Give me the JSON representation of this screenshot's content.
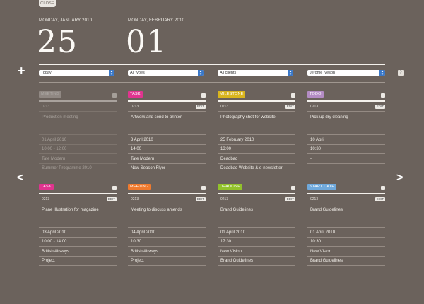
{
  "close_label": "CLOSE",
  "dates": [
    {
      "label": "MONDAY, JANUARY 2010",
      "day": "25"
    },
    {
      "label": "MONDAY, FEBRUARY 2010",
      "day": "01"
    }
  ],
  "filters": [
    {
      "value": "Today"
    },
    {
      "value": "All types"
    },
    {
      "value": "All clients"
    },
    {
      "value": "Jerome Iveson"
    }
  ],
  "help_label": "?",
  "nav": {
    "prev": "<",
    "next": ">"
  },
  "colors": {
    "background": "#6b625c",
    "meeting_faded": "#bdb8b3",
    "task": "#e0348f",
    "milestone": "#d9b51e",
    "todo": "#b48cc4",
    "meeting": "#f07a2e",
    "deadline": "#92c22b",
    "start_date": "#6fa9dc",
    "select_arrow": "#3a78c8"
  },
  "cards": [
    {
      "tag": "MEETING",
      "color": "meeting_faded",
      "num": "0213",
      "edit": "",
      "title": "Production meeting",
      "date": "01 April 2010",
      "time": "10:00 - 12:00",
      "client": "Tate Modern",
      "project": "Summer Programme 2010",
      "faded": true
    },
    {
      "tag": "TASK",
      "color": "task",
      "num": "0213",
      "edit": "EDIT",
      "title": "Artwork and send to printer",
      "date": "3 April 2010",
      "time": "14:00",
      "client": "Tate Modern",
      "project": "New Season Flyer",
      "faded": false
    },
    {
      "tag": "MILESTONE",
      "color": "milestone",
      "num": "0213",
      "edit": "EDIT",
      "title": "Photography shot for website",
      "date": "25 February 2010",
      "time": "13:00",
      "client": "Deadbad",
      "project": "Deadbad Website & e-newsletter",
      "faded": false
    },
    {
      "tag": "TODO",
      "color": "todo",
      "num": "0213",
      "edit": "EDIT",
      "title": "Pick up dry cleaning",
      "date": "10 April",
      "time": "10:30",
      "client": "-",
      "project": "-",
      "faded": false
    },
    {
      "tag": "TASK",
      "color": "task",
      "num": "0213",
      "edit": "EDIT",
      "title": "Plane Illustration for magazine",
      "date": "03 April 2010",
      "time": "10:00 - 14:00",
      "client": "British Airways",
      "project": "Project",
      "faded": false
    },
    {
      "tag": "MEETING",
      "color": "meeting",
      "num": "0213",
      "edit": "EDIT",
      "title": "Meeting to discuss amends",
      "date": "04 April 2010",
      "time": "10:30",
      "client": "British Airways",
      "project": "Project",
      "faded": false
    },
    {
      "tag": "DEADLINE",
      "color": "deadline",
      "num": "0213",
      "edit": "EDIT",
      "title": "Brand Guidelines",
      "date": "01 April 2010",
      "time": "17:30",
      "client": "New Vision",
      "project": "Brand Guidelines",
      "faded": false
    },
    {
      "tag": "START DATE",
      "color": "start_date",
      "num": "0213",
      "edit": "EDIT",
      "title": "Brand Guidelines",
      "date": "01 April 2010",
      "time": "10:30",
      "client": "New Vision",
      "project": "Brand Guidelines",
      "faded": false
    }
  ]
}
